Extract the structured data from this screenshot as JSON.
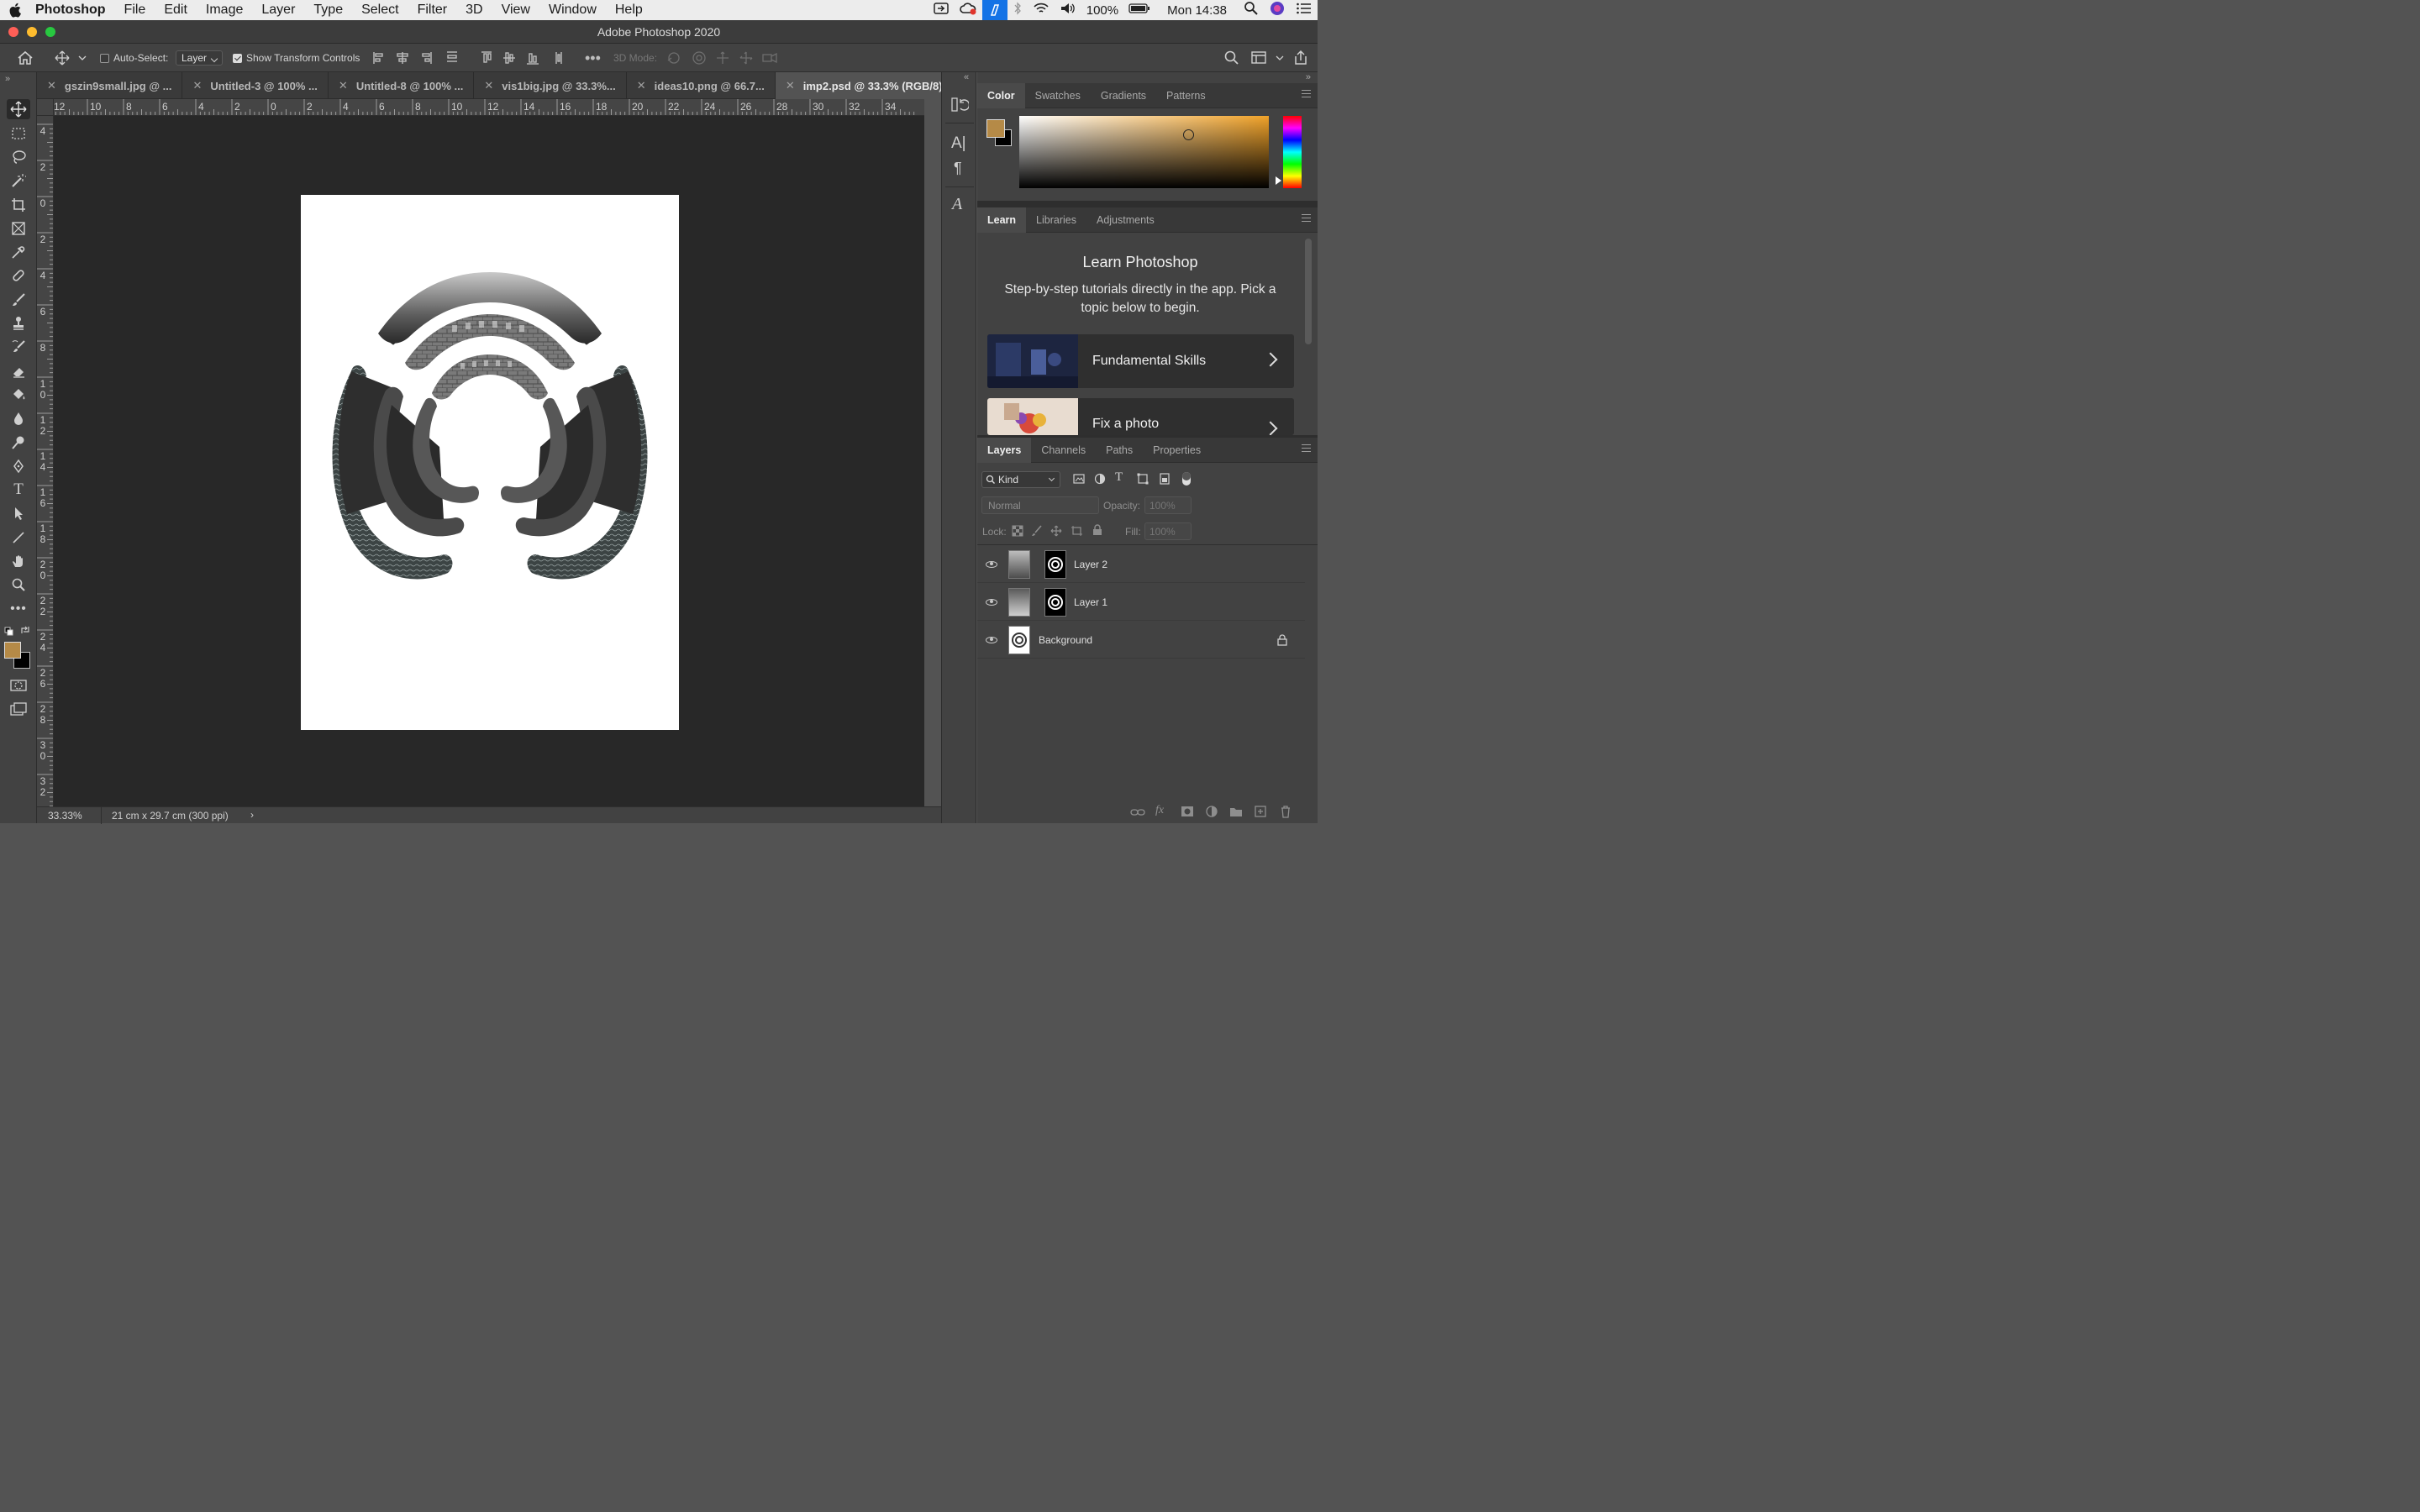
{
  "menubar": {
    "app": "Photoshop",
    "items": [
      "File",
      "Edit",
      "Image",
      "Layer",
      "Type",
      "Select",
      "Filter",
      "3D",
      "View",
      "Window",
      "Help"
    ],
    "battery": "100%",
    "clock": "Mon 14:38"
  },
  "window": {
    "title": "Adobe Photoshop 2020"
  },
  "options": {
    "auto_select_label": "Auto-Select:",
    "auto_select_value": "Layer",
    "show_transform_label": "Show Transform Controls",
    "mode_3d_label": "3D Mode:"
  },
  "tabs": [
    {
      "label": "gszin9small.jpg @ ..."
    },
    {
      "label": "Untitled-3 @ 100% ..."
    },
    {
      "label": "Untitled-8 @ 100% ..."
    },
    {
      "label": "vis1big.jpg @ 33.3%..."
    },
    {
      "label": "ideas10.png @ 66.7..."
    },
    {
      "label": "imp2.psd @ 33.3% (RGB/8)"
    }
  ],
  "rulers": {
    "horizontal": [
      "12",
      "10",
      "8",
      "6",
      "4",
      "2",
      "0",
      "2",
      "4",
      "6",
      "8",
      "10",
      "12",
      "14",
      "16",
      "18",
      "20",
      "22",
      "24",
      "26",
      "28",
      "30",
      "32",
      "34"
    ],
    "vertical": [
      "4",
      "2",
      "0",
      "2",
      "4",
      "6",
      "8",
      "10",
      "12",
      "14",
      "16",
      "18",
      "20",
      "22",
      "24",
      "26",
      "28",
      "30",
      "32"
    ]
  },
  "status": {
    "zoom": "33.33%",
    "doc_size": "21 cm x 29.7 cm (300 ppi)",
    "arrow": "›"
  },
  "color_panel": {
    "tabs": [
      "Color",
      "Swatches",
      "Gradients",
      "Patterns"
    ],
    "foreground": "#b58a47",
    "background": "#000000"
  },
  "learn_panel": {
    "tabs": [
      "Learn",
      "Libraries",
      "Adjustments"
    ],
    "title": "Learn Photoshop",
    "description": "Step-by-step tutorials directly in the app. Pick a topic below to begin.",
    "cards": [
      {
        "label": "Fundamental Skills"
      },
      {
        "label": "Fix a photo"
      }
    ]
  },
  "layers_panel": {
    "tabs": [
      "Layers",
      "Channels",
      "Paths",
      "Properties"
    ],
    "filter_kind": "Kind",
    "blend_mode": "Normal",
    "opacity_label": "Opacity:",
    "opacity_value": "100%",
    "lock_label": "Lock:",
    "fill_label": "Fill:",
    "fill_value": "100%",
    "layers": [
      {
        "name": "Layer 2",
        "visible": true
      },
      {
        "name": "Layer 1",
        "visible": true
      },
      {
        "name": "Background",
        "visible": true,
        "locked": true
      }
    ]
  },
  "colors": {
    "accent": "#1473e6",
    "canvas_bg": "#282828",
    "panel_bg": "#424242"
  }
}
